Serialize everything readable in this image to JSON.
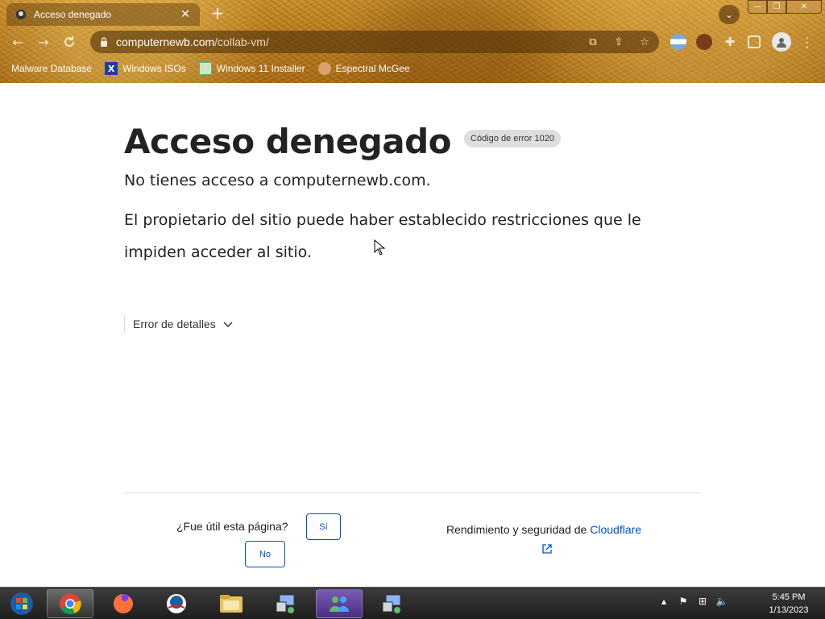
{
  "browser": {
    "tab_title": "Acceso denegado",
    "url_host": "computernewb.com",
    "url_path": "/collab-vm/",
    "bookmarks": [
      {
        "label": "Malware Database",
        "icon": "malware-icon"
      },
      {
        "label": "Windows ISOs",
        "icon": "x-icon"
      },
      {
        "label": "Windows 11 Installer",
        "icon": "image-icon"
      },
      {
        "label": "Espectral McGee",
        "icon": "avatar-icon"
      }
    ]
  },
  "page": {
    "heading": "Acceso denegado",
    "error_code": "Código de error 1020",
    "message1": "No tienes acceso a computernewb.com.",
    "message2": "El propietario del sitio puede haber establecido restricciones que le impiden acceder al sitio.",
    "details_label": "Error de detalles",
    "feedback_question": "¿Fue útil esta página?",
    "yes_label": "Sí",
    "no_label": "No",
    "perf_prefix": "Rendimiento y seguridad de ",
    "perf_link": "Cloudflare"
  },
  "taskbar": {
    "time": "5:45 PM",
    "date": "1/13/2023"
  },
  "colors": {
    "link": "#0051c3",
    "heading": "#222222",
    "badge_bg": "#dedede"
  }
}
